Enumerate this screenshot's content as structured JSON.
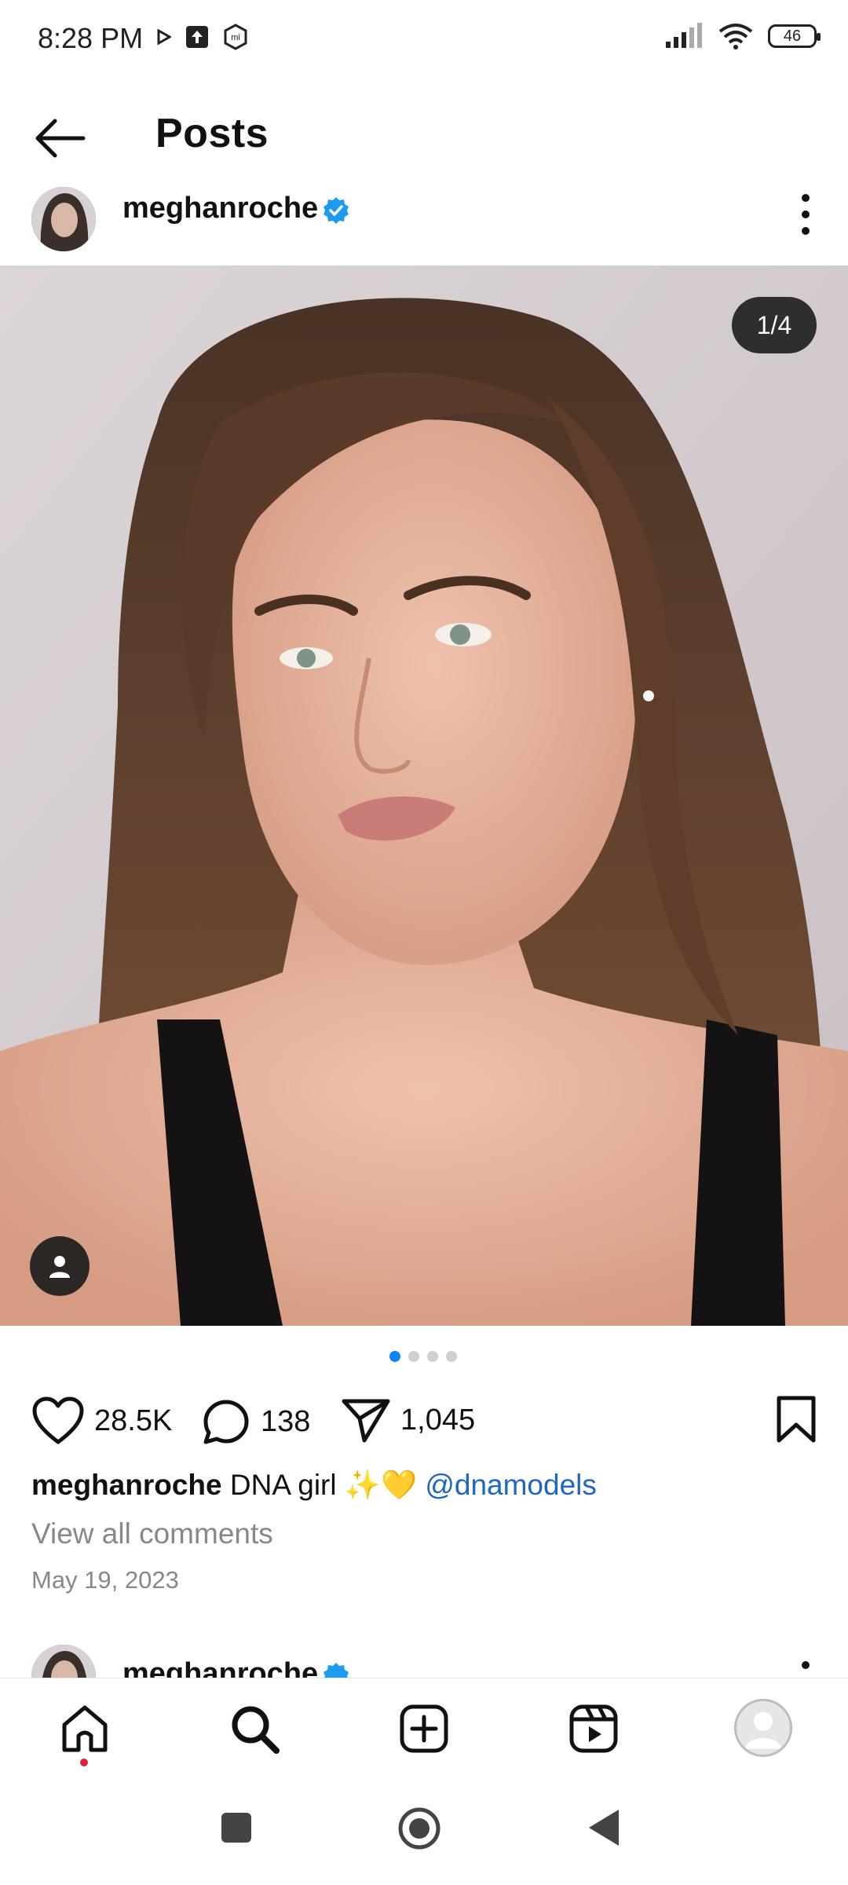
{
  "status_bar": {
    "time": "8:28 PM",
    "battery": "46",
    "icons": [
      "play-icon",
      "upload-icon",
      "mi-icon",
      "signal-icon",
      "wifi-icon",
      "battery-icon"
    ]
  },
  "header": {
    "title": "Posts"
  },
  "post": {
    "username": "meghanroche",
    "image_counter": "1/4",
    "likes": "28.5K",
    "comments": "138",
    "shares": "1,045",
    "caption_user": "meghanroche",
    "caption_text": " DNA girl ✨💛 ",
    "caption_mention": "@dnamodels",
    "view_comments": "View all comments",
    "date": "May 19, 2023",
    "carousel_total": 4,
    "carousel_active": 1
  },
  "next_post": {
    "username": "meghanroche"
  },
  "colors": {
    "accent_blue": "#0a84ff",
    "mention_blue": "#1f66c4",
    "notification_red": "#e0213a"
  }
}
